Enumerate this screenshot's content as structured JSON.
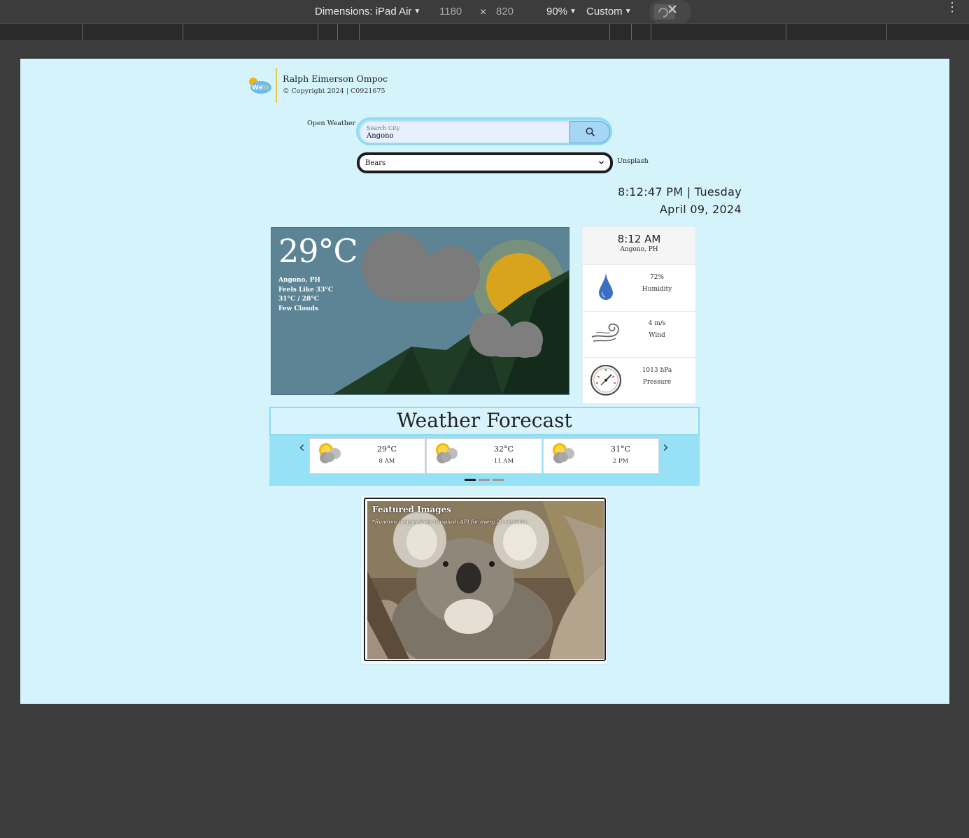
{
  "devtools": {
    "dimensions_label": "Dimensions: iPad Air",
    "width": "1180",
    "times": "×",
    "height": "820",
    "zoom": "90%",
    "throttle": "Custom",
    "more": "⋮"
  },
  "header": {
    "author": "Ralph Eimerson Ompoc",
    "copyright": "© Copyright 2024 | C0921675",
    "logo_text": "WeDir"
  },
  "search": {
    "left_label": "Open Weather",
    "placeholder": "Search City",
    "value": "Angono"
  },
  "image_select": {
    "selected": "Bears",
    "right_label": "Unsplash"
  },
  "clock": {
    "time_day": "8:12:47 PM | Tuesday",
    "date": "April 09, 2024"
  },
  "current": {
    "temperature": "29°C",
    "location": "Angono, PH",
    "feels_like": "Feels Like 33°C",
    "high_low": "31°C / 28°C",
    "description": "Few Clouds"
  },
  "details": {
    "time": "8:12 AM",
    "location": "Angono, PH",
    "humidity_value": "72%",
    "humidity_label": "Humidity",
    "wind_value": "4 m/s",
    "wind_label": "Wind",
    "pressure_value": "1013 hPa",
    "pressure_label": "Pressure"
  },
  "forecast": {
    "title": "Weather Forecast",
    "prev": "‹",
    "next": "›",
    "items": [
      {
        "temp": "29°C",
        "hour": "8 AM"
      },
      {
        "temp": "32°C",
        "hour": "11 AM"
      },
      {
        "temp": "31°C",
        "hour": "2 PM"
      }
    ],
    "active_page": 1,
    "pages": 3
  },
  "featured": {
    "title": "Featured Images",
    "subtitle": "*Random images from Unsplash API for every 20 seconds."
  },
  "colors": {
    "page_bg": "#d5f3fb",
    "accent": "#8ddaf2",
    "hero_sky": "#5d8494"
  }
}
